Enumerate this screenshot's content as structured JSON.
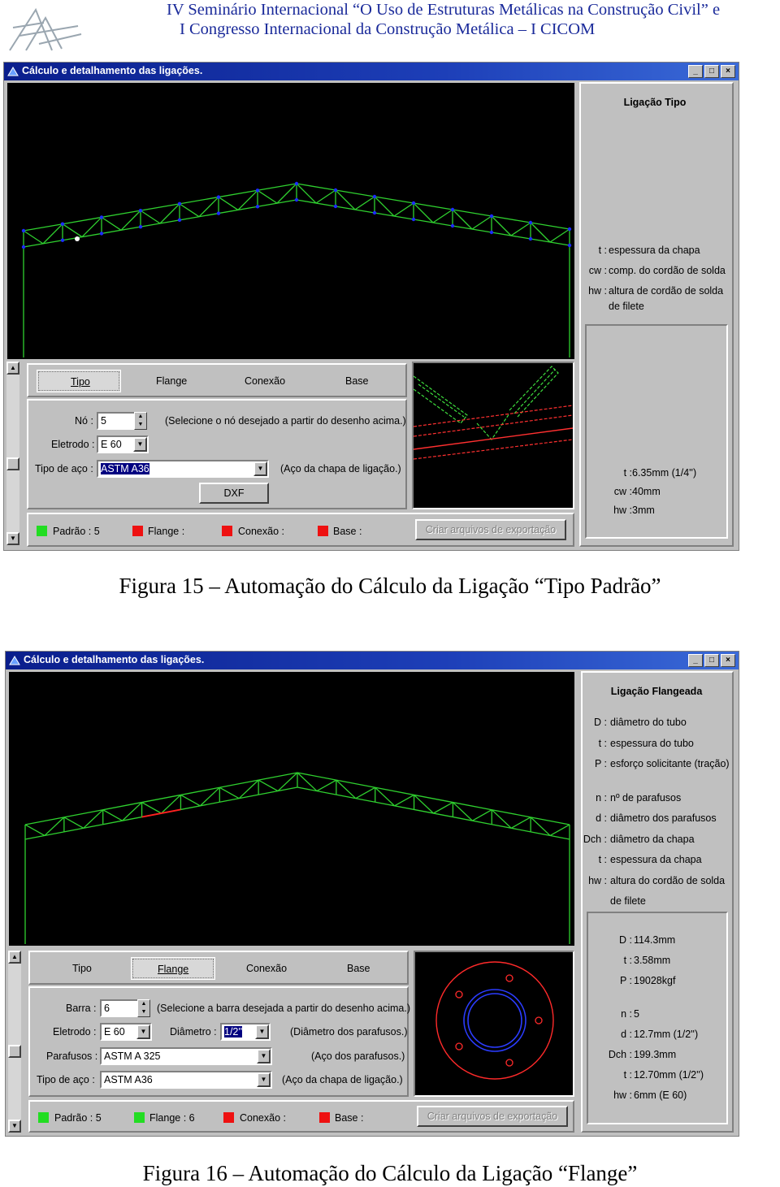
{
  "header": {
    "line1": "IV Seminário Internacional “O Uso de Estruturas Metálicas na Construção Civil” e",
    "line2": "I Congresso Internacional da Construção Metálica – I CICOM"
  },
  "fig15": {
    "window_title": "Cálculo e detalhamento das ligações.",
    "tabs": [
      "Tipo",
      "Flange",
      "Conexão",
      "Base"
    ],
    "no_label": "Nó :",
    "no_value": "5",
    "no_hint": "(Selecione o nó desejado a partir do desenho acima.)",
    "eletrodo_label": "Eletrodo :",
    "eletrodo_value": "E 60",
    "tipo_aco_label": "Tipo de aço :",
    "tipo_aco_value": "ASTM A36",
    "tipo_aco_hint": "(Aço da chapa de ligação.)",
    "dxf_button": "DXF",
    "status": [
      "Padrão : 5",
      "Flange :",
      "Conexão :",
      "Base :"
    ],
    "export_button": "Criar arquivos de exportação",
    "panel_title": "Ligação Tipo",
    "legend": [
      {
        "k": "t :",
        "v": "espessura da chapa"
      },
      {
        "k": "cw :",
        "v": "comp. do cordão de solda"
      },
      {
        "k": "hw :",
        "v": "altura de cordão de solda"
      },
      {
        "k": "",
        "v": "de filete"
      }
    ],
    "results": [
      {
        "k": "t :",
        "v": "6.35mm (1/4'')"
      },
      {
        "k": "cw :",
        "v": "40mm"
      },
      {
        "k": "hw :",
        "v": "3mm"
      }
    ],
    "caption": "Figura 15 – Automação do Cálculo da Ligação “Tipo Padrão”"
  },
  "fig16": {
    "window_title": "Cálculo e detalhamento das ligações.",
    "tabs": [
      "Tipo",
      "Flange",
      "Conexão",
      "Base"
    ],
    "barra_label": "Barra :",
    "barra_value": "6",
    "barra_hint": "(Selecione a barra desejada a partir do desenho acima.)",
    "eletrodo_label": "Eletrodo :",
    "eletrodo_value": "E 60",
    "diametro_label": "Diâmetro :",
    "diametro_value": "1/2''",
    "diametro_hint": "(Diâmetro dos parafusos.)",
    "parafusos_label": "Parafusos :",
    "parafusos_value": "ASTM A 325",
    "parafusos_hint": "(Aço dos parafusos.)",
    "tipo_aco_label": "Tipo de aço :",
    "tipo_aco_value": "ASTM A36",
    "tipo_aco_hint": "(Aço da chapa de ligação.)",
    "status": [
      "Padrão : 5",
      "Flange : 6",
      "Conexão :",
      "Base :"
    ],
    "export_button": "Criar arquivos de exportação",
    "panel_title": "Ligação Flangeada",
    "legend": [
      {
        "k": "D :",
        "v": "diâmetro do tubo"
      },
      {
        "k": "t :",
        "v": "espessura do tubo"
      },
      {
        "k": "P :",
        "v": "esforço solicitante (tração)"
      },
      {
        "k": "n :",
        "v": "nº de parafusos"
      },
      {
        "k": "d :",
        "v": "diâmetro dos parafusos"
      },
      {
        "k": "Dch :",
        "v": "diâmetro da chapa"
      },
      {
        "k": "t :",
        "v": "espessura da chapa"
      },
      {
        "k": "hw :",
        "v": "altura do cordão de solda"
      },
      {
        "k": "",
        "v": "de filete"
      }
    ],
    "results": [
      {
        "k": "D :",
        "v": "114.3mm"
      },
      {
        "k": "t :",
        "v": "3.58mm"
      },
      {
        "k": "P :",
        "v": "19028kgf"
      },
      {
        "k": "n :",
        "v": "5"
      },
      {
        "k": "d :",
        "v": "12.7mm (1/2'')"
      },
      {
        "k": "Dch :",
        "v": "199.3mm"
      },
      {
        "k": "t :",
        "v": "12.70mm (1/2'')"
      },
      {
        "k": "hw :",
        "v": "6mm (E 60)"
      }
    ],
    "caption": "Figura 16 – Automação do Cálculo da Ligação “Flange”"
  },
  "colors": {
    "title_bar": "#0a1e8c",
    "truss": "#2fd02f",
    "node": "#1d2cff",
    "selected": "#ff2020",
    "status_green": "#22dd22",
    "status_red": "#ee1111"
  }
}
